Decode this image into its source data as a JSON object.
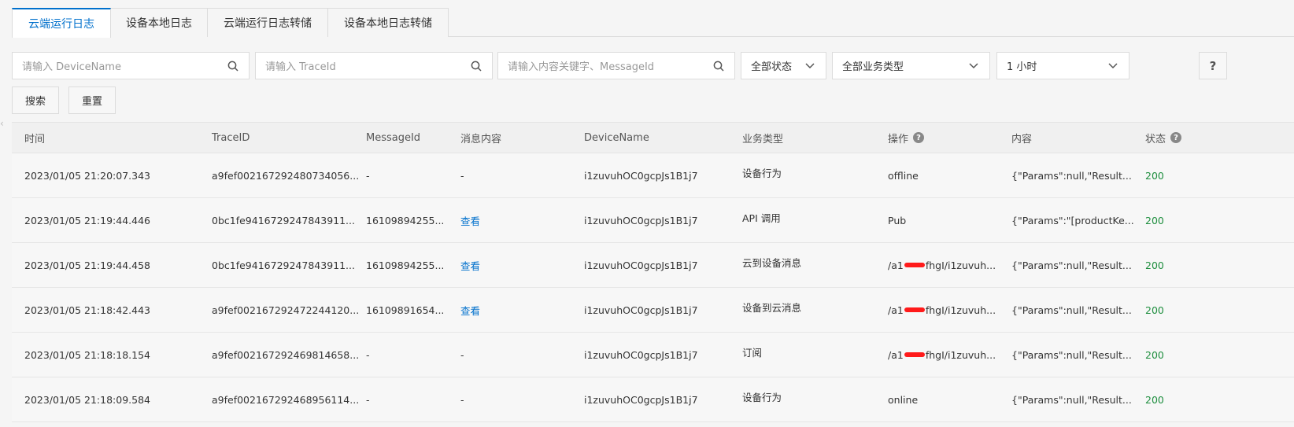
{
  "tabs": [
    "云端运行日志",
    "设备本地日志",
    "云端运行日志转储",
    "设备本地日志转储"
  ],
  "filters": {
    "device_placeholder": "请输入 DeviceName",
    "trace_placeholder": "请输入 TraceId",
    "content_placeholder": "请输入内容关键字、MessageId",
    "status_value": "全部状态",
    "biz_type_value": "全部业务类型",
    "time_value": "1 小时",
    "help_label": "?"
  },
  "actions": {
    "search_label": "搜索",
    "reset_label": "重置"
  },
  "table": {
    "headers": {
      "time": "时间",
      "trace_id": "TraceID",
      "message_id": "MessageId",
      "msg_content": "消息内容",
      "device_name": "DeviceName",
      "biz_type": "业务类型",
      "operation": "操作",
      "content": "内容",
      "status": "状态"
    },
    "rows": [
      {
        "time": "2023/01/05 21:20:07.343",
        "trace_id": "a9fef002167292480734056...",
        "message_id": "-",
        "msg_content": "-",
        "device_name": "i1zuvuhOC0gcpJs1B1j7",
        "biz_type": "设备行为",
        "operation": "offline",
        "content": "{\"Params\":null,\"Result...",
        "status": "200"
      },
      {
        "time": "2023/01/05 21:19:44.446",
        "trace_id": "0bc1fe9416729247843911...",
        "message_id": "16109894255...",
        "msg_content": "查看",
        "device_name": "i1zuvuhOC0gcpJs1B1j7",
        "biz_type": "API 调用",
        "operation": "Pub",
        "content": "{\"Params\":\"[productKe...",
        "status": "200"
      },
      {
        "time": "2023/01/05 21:19:44.458",
        "trace_id": "0bc1fe9416729247843911...",
        "message_id": "16109894255...",
        "msg_content": "查看",
        "device_name": "i1zuvuhOC0gcpJs1B1j7",
        "biz_type": "云到设备消息",
        "operation": "/a1",
        "operation_tail": "fhgI/i1zuvuh...",
        "content": "{\"Params\":null,\"Result...",
        "status": "200"
      },
      {
        "time": "2023/01/05 21:18:42.443",
        "trace_id": "a9fef002167292472244120...",
        "message_id": "16109891654...",
        "msg_content": "查看",
        "device_name": "i1zuvuhOC0gcpJs1B1j7",
        "biz_type": "设备到云消息",
        "operation": "/a1",
        "operation_tail": "fhgI/i1zuvuh...",
        "content": "{\"Params\":null,\"Result...",
        "status": "200"
      },
      {
        "time": "2023/01/05 21:18:18.154",
        "trace_id": "a9fef002167292469814658...",
        "message_id": "-",
        "msg_content": "-",
        "device_name": "i1zuvuhOC0gcpJs1B1j7",
        "biz_type": "订阅",
        "operation": "/a1",
        "operation_tail": "fhgI/i1zuvuh...",
        "content": "{\"Params\":null,\"Result...",
        "status": "200"
      },
      {
        "time": "2023/01/05 21:18:09.584",
        "trace_id": "a9fef002167292468956114...",
        "message_id": "-",
        "msg_content": "-",
        "device_name": "i1zuvuhOC0gcpJs1B1j7",
        "biz_type": "设备行为",
        "operation": "online",
        "content": "{\"Params\":null,\"Result...",
        "status": "200"
      }
    ]
  },
  "colors": {
    "accent": "#0070cc",
    "success": "#1e8e3e",
    "redaction": "#ff1a1a"
  },
  "icons": {
    "search": "search-icon",
    "chevron": "chevron-down-icon",
    "help": "question-circle-icon"
  }
}
